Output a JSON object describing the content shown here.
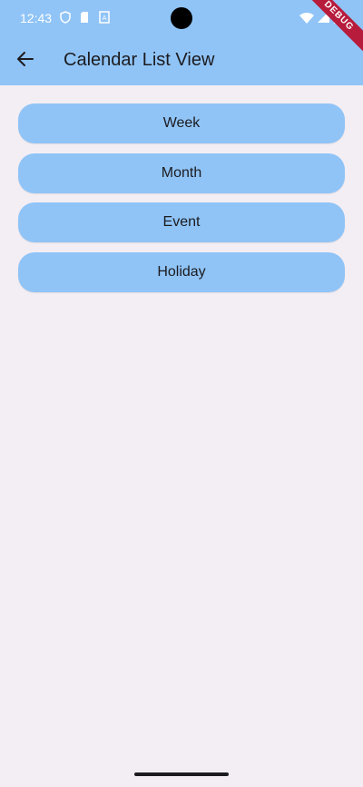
{
  "status_bar": {
    "time": "12:43",
    "icons_left": [
      "shield-icon",
      "sim-card-icon",
      "app-notification-icon"
    ],
    "icons_right": [
      "wifi-icon",
      "signal-icon",
      "battery-icon"
    ]
  },
  "debug_banner": "DEBUG",
  "app_bar": {
    "back_icon": "arrow-left-icon",
    "title": "Calendar List View"
  },
  "buttons": [
    {
      "label": "Week"
    },
    {
      "label": "Month"
    },
    {
      "label": "Event"
    },
    {
      "label": "Holiday"
    }
  ],
  "colors": {
    "primary": "#90c4f7",
    "background": "#f3eef4",
    "text": "#1c1b1f",
    "debug": "#b71c3c"
  }
}
